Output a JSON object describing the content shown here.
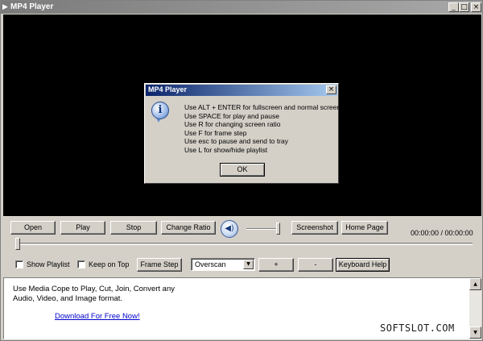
{
  "window": {
    "title": "MP4 Player",
    "title_icon": "play-arrow-icon",
    "minimize_glyph": "_",
    "maximize_glyph": "□",
    "close_glyph": "×"
  },
  "dialog": {
    "title": "MP4 Player",
    "close_glyph": "×",
    "icon": "info-icon",
    "icon_glyph": "i",
    "lines": [
      "Use ALT + ENTER for fullscreen and normal screen",
      "Use SPACE for play and pause",
      "Use R for changing screen ratio",
      "Use F for frame step",
      "Use esc to pause and send to tray",
      "Use L for show/hide playlist"
    ],
    "ok_label": "OK"
  },
  "controls": {
    "open_label": "Open",
    "play_label": "Play",
    "stop_label": "Stop",
    "change_ratio_label": "Change Ratio",
    "volume_icon": "speaker-icon",
    "volume_glyph": "◀)",
    "volume_level": 1.0,
    "screenshot_label": "Screenshot",
    "home_page_label": "Home Page",
    "time_display": "00:00:00 / 00:00:00",
    "seek_position": 0,
    "show_playlist_label": "Show Playlist",
    "show_playlist_checked": false,
    "keep_on_top_label": "Keep on Top",
    "keep_on_top_checked": false,
    "frame_step_label": "Frame Step",
    "display_mode_value": "Overscan",
    "dropdown_arrow": "▼",
    "plus_label": "+",
    "minus_label": "-",
    "keyboard_help_label": "Keyboard Help"
  },
  "ad": {
    "text": "Use Media Cope to Play, Cut, Join, Convert any Audio, Video, and Image format.",
    "link_text": "Download For Free Now!",
    "scroll_up_glyph": "▲",
    "scroll_down_glyph": "▼"
  },
  "watermark": "SOFTSLOT.COM",
  "colors": {
    "window_bg": "#d4d0c8",
    "video_bg": "#000000",
    "dialog_title_bg": "#0a246a",
    "link": "#0000cc"
  }
}
